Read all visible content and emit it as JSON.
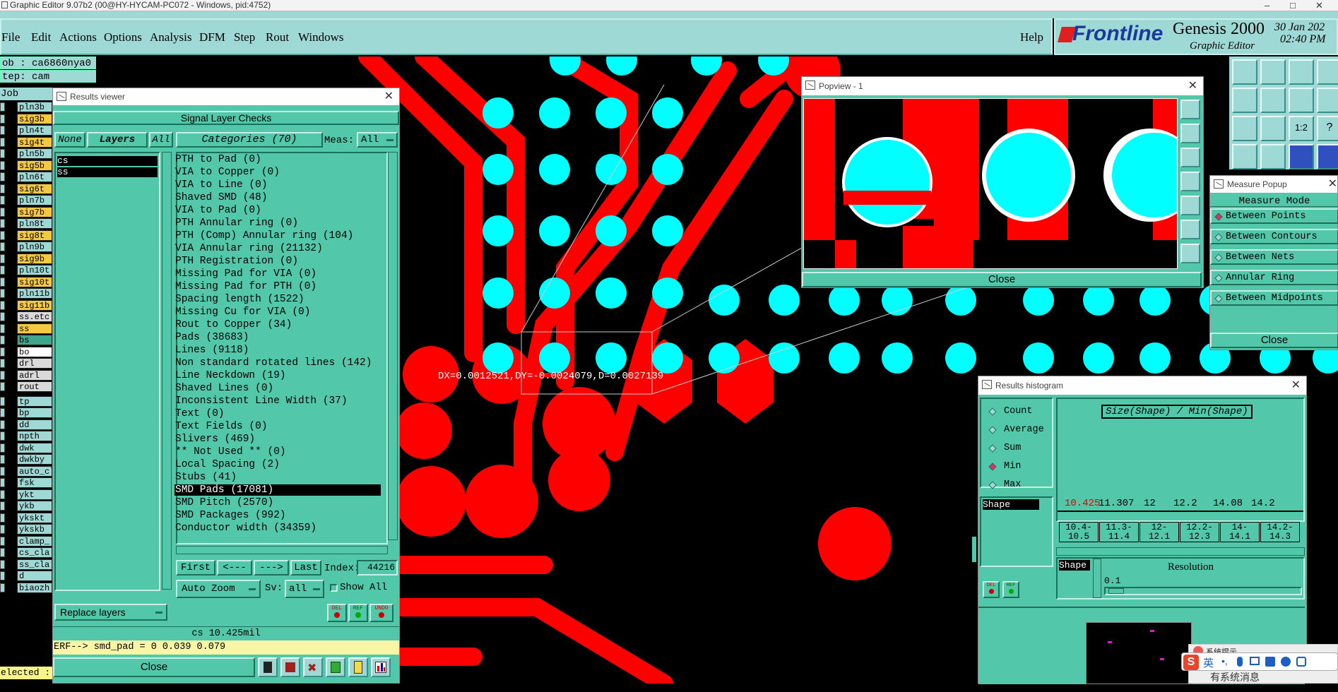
{
  "window_title": "Graphic Editor 9.07b2 (00@HY-HYCAM-PC072 - Windows, pid:4752)",
  "menu": [
    "File",
    "Edit",
    "Actions",
    "Options",
    "Analysis",
    "DFM",
    "Step",
    "Rout",
    "Windows"
  ],
  "help": "Help",
  "brand": {
    "logo": "Frontline",
    "product": "Genesis 2000",
    "subtitle": "Graphic Editor",
    "date": "30 Jan 202",
    "time": "02:40 PM"
  },
  "job": {
    "job": "ob : ca6860nya0",
    "step": "tep: cam",
    "matrix": "Job Matri"
  },
  "layers": [
    {
      "name": "pln3b",
      "color": "#9fd9d6"
    },
    {
      "name": "sig3b",
      "color": "#f5c842"
    },
    {
      "name": "pln4t",
      "color": "#9fd9d6"
    },
    {
      "name": "sig4t",
      "color": "#f5c842"
    },
    {
      "name": "pln5b",
      "color": "#9fd9d6"
    },
    {
      "name": "sig5b",
      "color": "#f5c842"
    },
    {
      "name": "pln6t",
      "color": "#9fd9d6"
    },
    {
      "name": "sig6t",
      "color": "#f5c842"
    },
    {
      "name": "pln7b",
      "color": "#9fd9d6"
    },
    {
      "name": "sig7b",
      "color": "#f5c842"
    },
    {
      "name": "pln8t",
      "color": "#9fd9d6"
    },
    {
      "name": "sig8t",
      "color": "#f5c842"
    },
    {
      "name": "pln9b",
      "color": "#9fd9d6"
    },
    {
      "name": "sig9b",
      "color": "#f5c842"
    },
    {
      "name": "pln10t",
      "color": "#9fd9d6"
    },
    {
      "name": "sig10t",
      "color": "#f5c842"
    },
    {
      "name": "pln11b",
      "color": "#9fd9d6"
    },
    {
      "name": "sig11b",
      "color": "#f5c842"
    },
    {
      "name": "ss.etc",
      "color": "#d9d9d9"
    },
    {
      "name": "ss",
      "color": "#f5c842"
    },
    {
      "name": "bs",
      "color": "#3da68c"
    },
    {
      "name": "bo",
      "color": "#ffffff"
    },
    {
      "name": "drl",
      "color": "#d9d9d9"
    },
    {
      "name": "adrl",
      "color": "#d9d9d9"
    },
    {
      "name": "rout",
      "color": "#d9d9d9"
    },
    {
      "name": "tp",
      "color": "#9fd9d6"
    },
    {
      "name": "bp",
      "color": "#9fd9d6"
    },
    {
      "name": "dd",
      "color": "#9fd9d6"
    },
    {
      "name": "npth",
      "color": "#9fd9d6"
    },
    {
      "name": "dwk",
      "color": "#9fd9d6"
    },
    {
      "name": "dwkby",
      "color": "#9fd9d6"
    },
    {
      "name": "auto_cl",
      "color": "#9fd9d6"
    },
    {
      "name": "fsk",
      "color": "#9fd9d6"
    },
    {
      "name": "ykt",
      "color": "#9fd9d6"
    },
    {
      "name": "ykb",
      "color": "#9fd9d6"
    },
    {
      "name": "ykskt",
      "color": "#9fd9d6"
    },
    {
      "name": "ykskb",
      "color": "#9fd9d6"
    },
    {
      "name": "clamp_",
      "color": "#9fd9d6"
    },
    {
      "name": "cs_cla",
      "color": "#9fd9d6"
    },
    {
      "name": "ss_cla",
      "color": "#9fd9d6"
    },
    {
      "name": "d",
      "color": "#9fd9d6"
    },
    {
      "name": "biaozh",
      "color": "#9fd9d6"
    }
  ],
  "selected_status": "elected : (",
  "results_viewer": {
    "title": "Results viewer",
    "header": "Signal Layer Checks",
    "none": "None",
    "layers": "Layers",
    "all": "All",
    "layer_list": [
      "cs",
      "ss"
    ],
    "categories": "Categories (70)",
    "meas_label": "Meas:",
    "meas_value": "All",
    "items": [
      "PTH to Pad (0)",
      "VIA to Copper (0)",
      "VIA to Line (0)",
      "Shaved SMD (48)",
      "VIA to Pad (0)",
      "PTH Annular ring (0)",
      "PTH (Comp) Annular ring (104)",
      "VIA Annular ring (21132)",
      "PTH Registration (0)",
      "Missing Pad for VIA (0)",
      "Missing Pad for PTH (0)",
      "Spacing length (1522)",
      "Missing Cu for VIA (0)",
      "Rout to Copper (34)",
      "Pads (38683)",
      "Lines (9118)",
      "Non standard rotated lines (142)",
      "Line Neckdown (19)",
      "Shaved Lines (0)",
      "Inconsistent Line Width (37)",
      "Text (0)",
      "Text Fields (0)",
      "Slivers (469)",
      "** Not Used ** (0)",
      "Local Spacing (2)",
      "Stubs (41)",
      "SMD Pads (17081)",
      "SMD Pitch (2570)",
      "SMD Packages (992)",
      "Conductor width (34359)"
    ],
    "selected_item": "SMD Pads (17081)",
    "nav": {
      "first": "First",
      "prev": "<---",
      "next": "--->",
      "last": "Last",
      "index_label": "Index:",
      "index_value": "44216"
    },
    "auto_zoom": "Auto Zoom",
    "sv_label": "Sv:",
    "sv_value": "all",
    "show_all": "Show All",
    "replace_layers": "Replace layers",
    "del": "DEL",
    "ref": "REF",
    "undo": "UNDO",
    "status": "cs 10.425mil",
    "erf": "ERF--> smd_pad = 0 0.039 0.079",
    "close": "Close"
  },
  "measure_text": "DX=0.0012521,DY=-0.0024079,D=0.0027139",
  "popview": {
    "title": "Popview - 1",
    "close": "Close"
  },
  "measure_popup": {
    "title": "Measure Popup",
    "header": "Measure Mode",
    "options": [
      "Between Points",
      "Between Contours",
      "Between Nets",
      "Annular Ring",
      "Between Midpoints"
    ],
    "selected": "Between Points",
    "close": "Close"
  },
  "histogram": {
    "title": "Results histogram",
    "options": [
      "Count",
      "Average",
      "Sum",
      "Min",
      "Max"
    ],
    "selected": "Min",
    "shape_label": "Shape",
    "chart_title": "Size(Shape) / Min(Shape)",
    "values": [
      "10.425",
      "11.307",
      "12",
      "12.2",
      "14.08",
      "14.2"
    ],
    "ranges": [
      [
        "10.4-",
        "10.5"
      ],
      [
        "11.3-",
        "11.4"
      ],
      [
        "12-",
        "12.1"
      ],
      [
        "12.2-",
        "12.3"
      ],
      [
        "14-",
        "14.1"
      ],
      [
        "14.2-",
        "14.3"
      ]
    ],
    "shape2": "Shape",
    "resolution_label": "Resolution",
    "resolution_value": "0.1",
    "del": "DEL",
    "ref": "REF"
  },
  "ime": {
    "tip": "系统提示",
    "lang": "英",
    "message": "有系统消息"
  }
}
